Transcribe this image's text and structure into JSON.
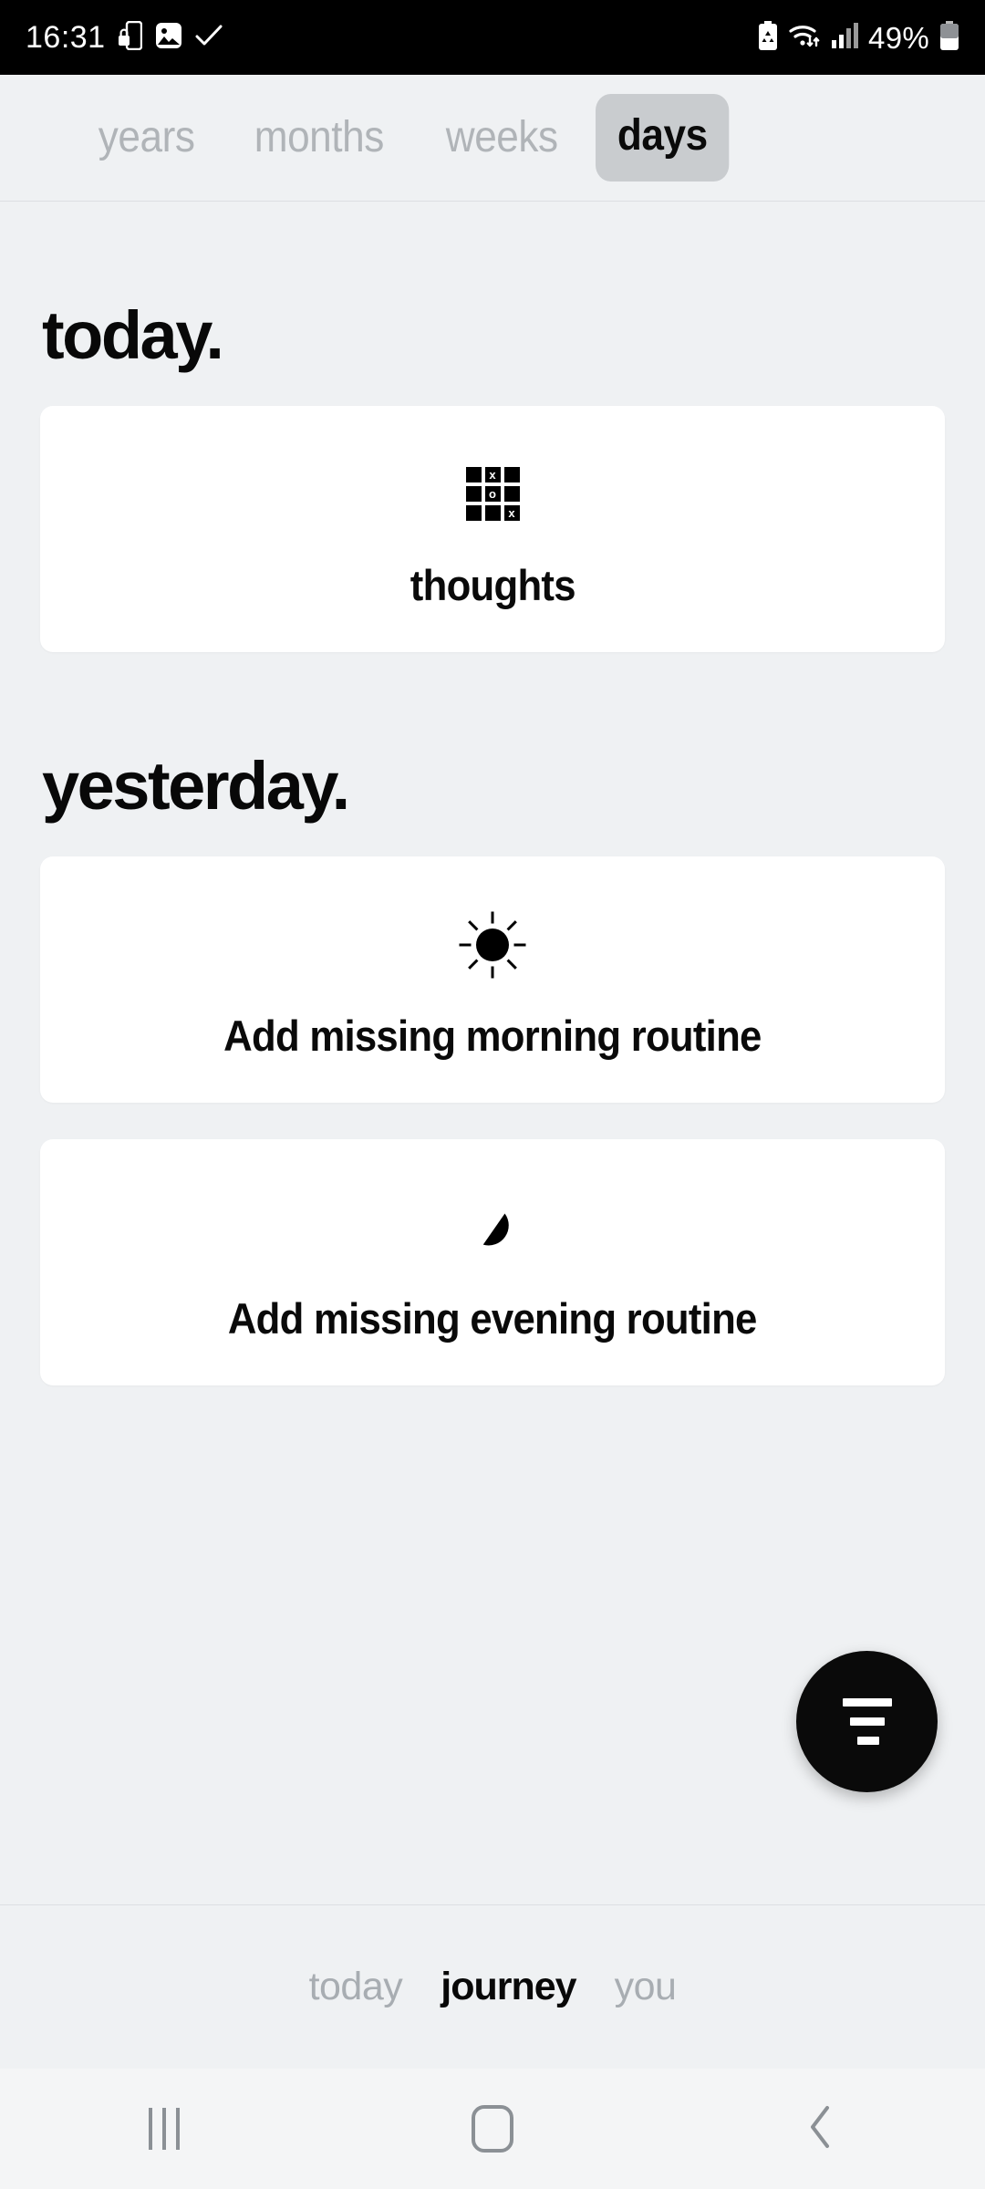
{
  "statusbar": {
    "time": "16:31",
    "battery_percent": "49%",
    "icons": [
      "phone-lock-icon",
      "image-icon",
      "check-icon",
      "battery-recycle-icon",
      "wifi-icon",
      "signal-icon",
      "battery-icon"
    ]
  },
  "tabs": {
    "items": [
      {
        "label": "years",
        "active": false
      },
      {
        "label": "months",
        "active": false
      },
      {
        "label": "weeks",
        "active": false
      },
      {
        "label": "days",
        "active": true
      }
    ]
  },
  "sections": [
    {
      "heading": "today.",
      "cards": [
        {
          "label": "thoughts",
          "icon": "tic-tac-toe-icon"
        }
      ]
    },
    {
      "heading": "yesterday.",
      "cards": [
        {
          "label": "Add missing morning routine",
          "icon": "sun-icon"
        },
        {
          "label": "Add missing evening routine",
          "icon": "moon-icon"
        }
      ]
    }
  ],
  "fab": {
    "icon": "filter-icon"
  },
  "bottom_nav": {
    "items": [
      {
        "label": "today",
        "active": false
      },
      {
        "label": "journey",
        "active": true
      },
      {
        "label": "you",
        "active": false
      }
    ]
  },
  "system_nav": {
    "items": [
      "recents-icon",
      "home-icon",
      "back-icon"
    ]
  },
  "colors": {
    "background": "#eff1f3",
    "card": "#ffffff",
    "accent": "#0a0a0a",
    "muted": "#a8adb2",
    "tab_active_bg": "#c9cccf"
  },
  "tictactoe": {
    "cells": [
      "",
      "x",
      "",
      "",
      "o",
      "",
      "",
      "",
      "x"
    ]
  }
}
